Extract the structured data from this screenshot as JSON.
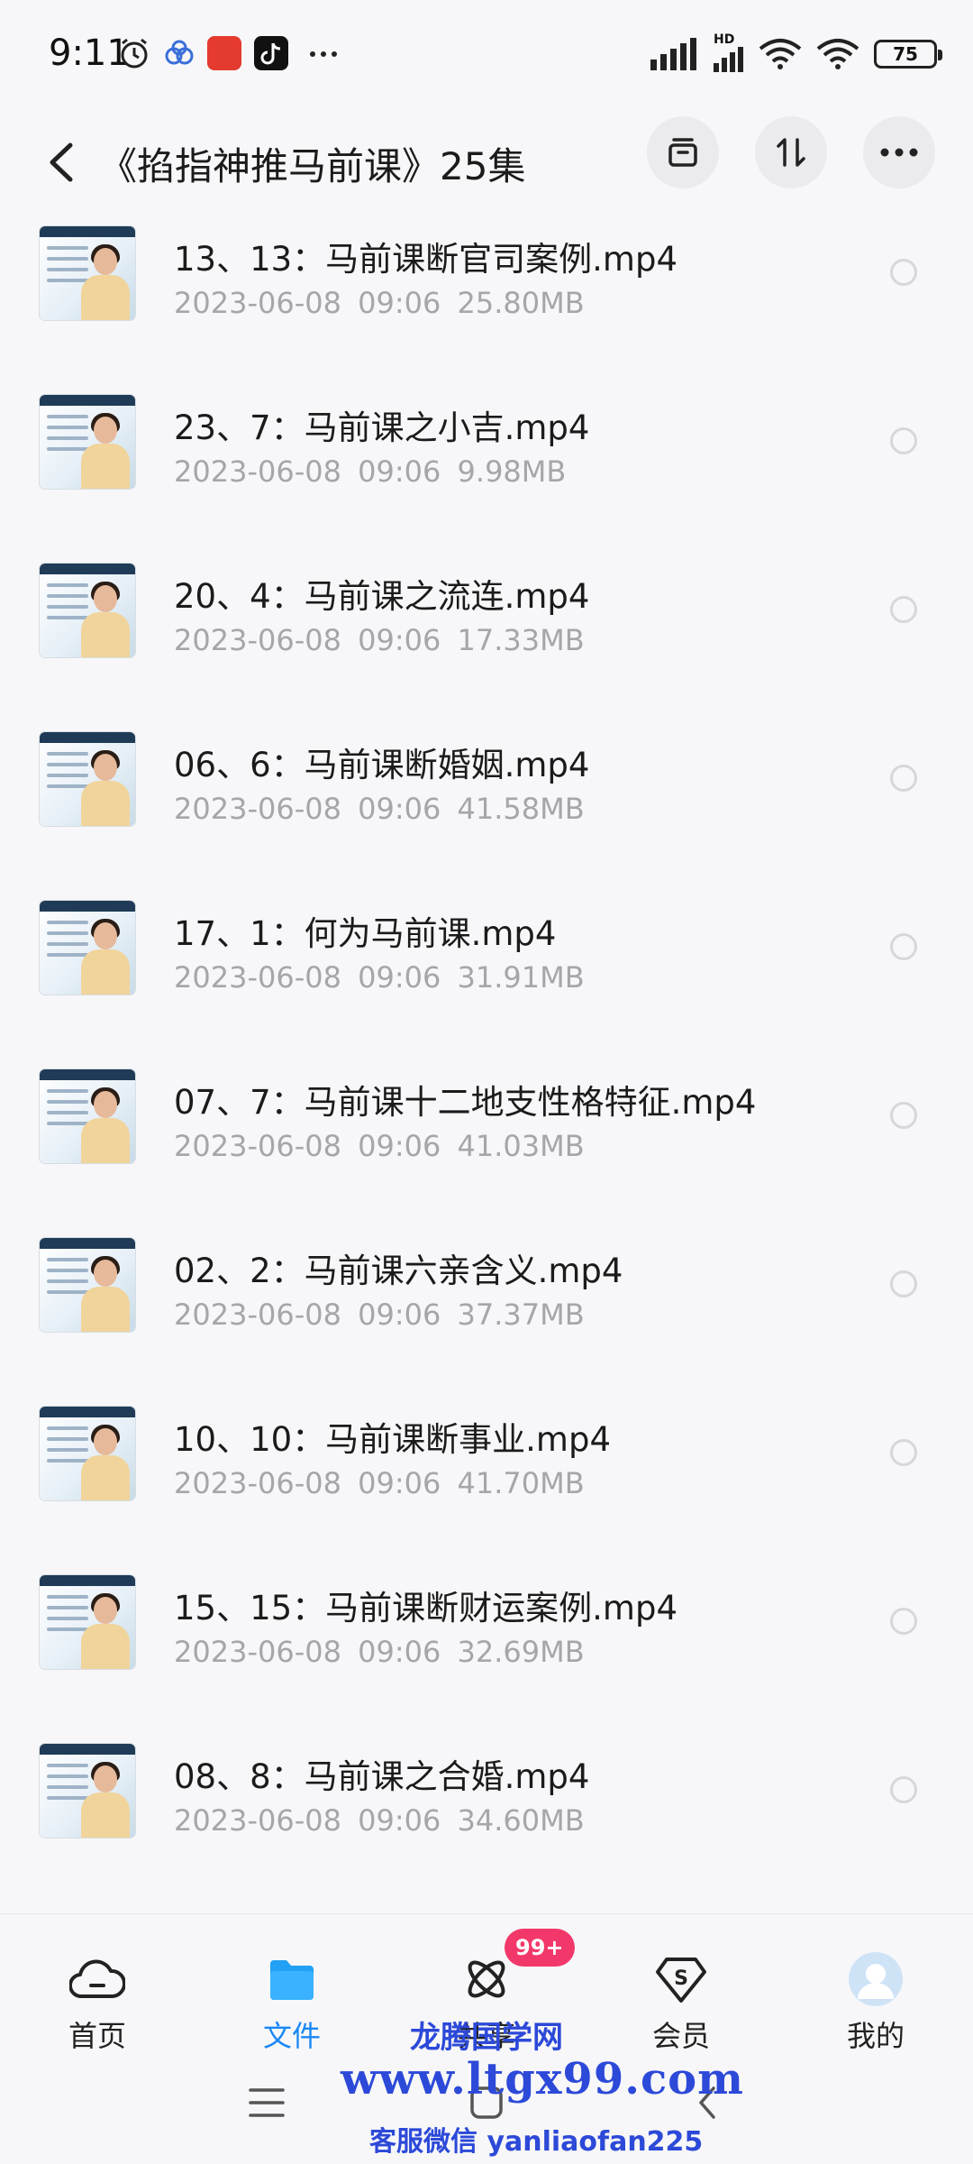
{
  "status_bar": {
    "time": "9:11",
    "battery": "75",
    "network_badge": "HD"
  },
  "header": {
    "title": "《掐指神推马前课》25集"
  },
  "files": [
    {
      "name": "13、13：马前课断官司案例.mp4",
      "date": "2023-06-08",
      "time": "09:06",
      "size": "25.80MB"
    },
    {
      "name": "23、7：马前课之小吉.mp4",
      "date": "2023-06-08",
      "time": "09:06",
      "size": "9.98MB"
    },
    {
      "name": "20、4：马前课之流连.mp4",
      "date": "2023-06-08",
      "time": "09:06",
      "size": "17.33MB"
    },
    {
      "name": "06、6：马前课断婚姻.mp4",
      "date": "2023-06-08",
      "time": "09:06",
      "size": "41.58MB"
    },
    {
      "name": "17、1：何为马前课.mp4",
      "date": "2023-06-08",
      "time": "09:06",
      "size": "31.91MB"
    },
    {
      "name": "07、7：马前课十二地支性格特征.mp4",
      "date": "2023-06-08",
      "time": "09:06",
      "size": "41.03MB"
    },
    {
      "name": "02、2：马前课六亲含义.mp4",
      "date": "2023-06-08",
      "time": "09:06",
      "size": "37.37MB"
    },
    {
      "name": "10、10：马前课断事业.mp4",
      "date": "2023-06-08",
      "time": "09:06",
      "size": "41.70MB"
    },
    {
      "name": "15、15：马前课断财运案例.mp4",
      "date": "2023-06-08",
      "time": "09:06",
      "size": "32.69MB"
    },
    {
      "name": "08、8：马前课之合婚.mp4",
      "date": "2023-06-08",
      "time": "09:06",
      "size": "34.60MB"
    }
  ],
  "bottom_nav": {
    "items": [
      {
        "label": "首页",
        "icon": "cloud-home-icon"
      },
      {
        "label": "文件",
        "icon": "folder-icon",
        "active": true
      },
      {
        "label": "共享",
        "icon": "share-orbit-icon"
      },
      {
        "label": "会员",
        "icon": "vip-s-icon"
      },
      {
        "label": "我的",
        "icon": "avatar-icon"
      }
    ],
    "badge": "99+"
  },
  "watermark": {
    "line1": "龙腾国学网",
    "line2": "www.ltgx99.com",
    "line3": "客服微信 yanliaofan225"
  },
  "colors": {
    "accent": "#1a88f5",
    "badge": "#f2386a",
    "watermark": "#2c49d8"
  }
}
